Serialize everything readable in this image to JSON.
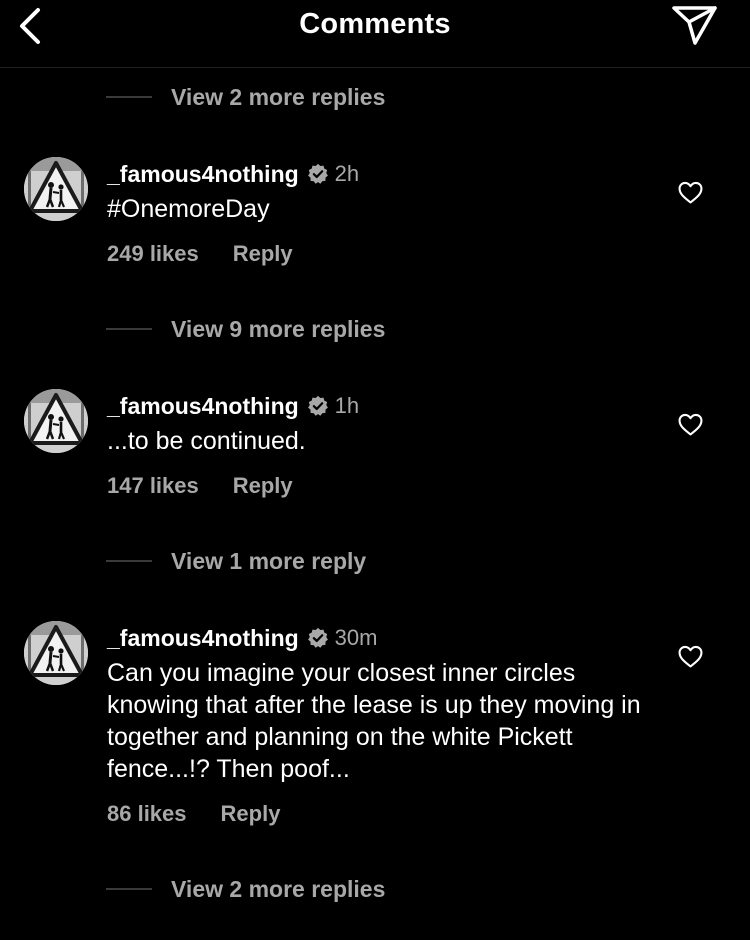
{
  "header": {
    "title": "Comments",
    "back_icon": "chevron-left-icon",
    "send_icon": "paper-plane-icon"
  },
  "colors": {
    "background": "#000000",
    "primary_text": "#ffffff",
    "secondary_text": "#a8a8a8",
    "verified_badge": "#a8a8a8"
  },
  "view_replies": [
    {
      "label": "View 2 more replies"
    },
    {
      "label": "View 9 more replies"
    },
    {
      "label": "View 1 more reply"
    },
    {
      "label": "View 2 more replies"
    }
  ],
  "comments": [
    {
      "username": "_famous4nothing",
      "verified": true,
      "time": "2h",
      "text": "#OnemoreDay",
      "likes": "249 likes",
      "reply_label": "Reply"
    },
    {
      "username": "_famous4nothing",
      "verified": true,
      "time": "1h",
      "text": "...to be continued.",
      "likes": "147 likes",
      "reply_label": "Reply"
    },
    {
      "username": "_famous4nothing",
      "verified": true,
      "time": "30m",
      "text": "Can you imagine your closest inner circles knowing that after the lease is up they moving in together and planning on the white Pickett fence...!? Then poof...",
      "likes": "86 likes",
      "reply_label": "Reply"
    }
  ]
}
